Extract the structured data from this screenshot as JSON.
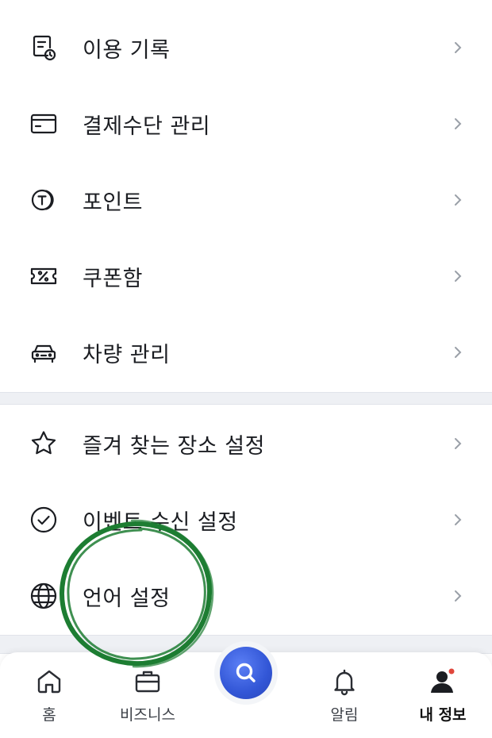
{
  "menu_group_1": [
    {
      "label": "이용 기록",
      "icon": "receipt-clock-icon"
    },
    {
      "label": "결제수단 관리",
      "icon": "card-icon"
    },
    {
      "label": "포인트",
      "icon": "coin-t-icon"
    },
    {
      "label": "쿠폰함",
      "icon": "coupon-percent-icon"
    },
    {
      "label": "차량 관리",
      "icon": "car-icon"
    }
  ],
  "menu_group_2": [
    {
      "label": "즐겨 찾는 장소 설정",
      "icon": "star-icon"
    },
    {
      "label": "이벤트 수신 설정",
      "icon": "check-circle-icon"
    },
    {
      "label": "언어 설정",
      "icon": "globe-icon"
    }
  ],
  "tabbar": {
    "home": "홈",
    "business": "비즈니스",
    "alerts": "알림",
    "my_info": "내 정보"
  },
  "colors": {
    "search_button": "#3256d6",
    "annotation_circle": "#1d7d32",
    "notification_dot": "#e0463b"
  }
}
